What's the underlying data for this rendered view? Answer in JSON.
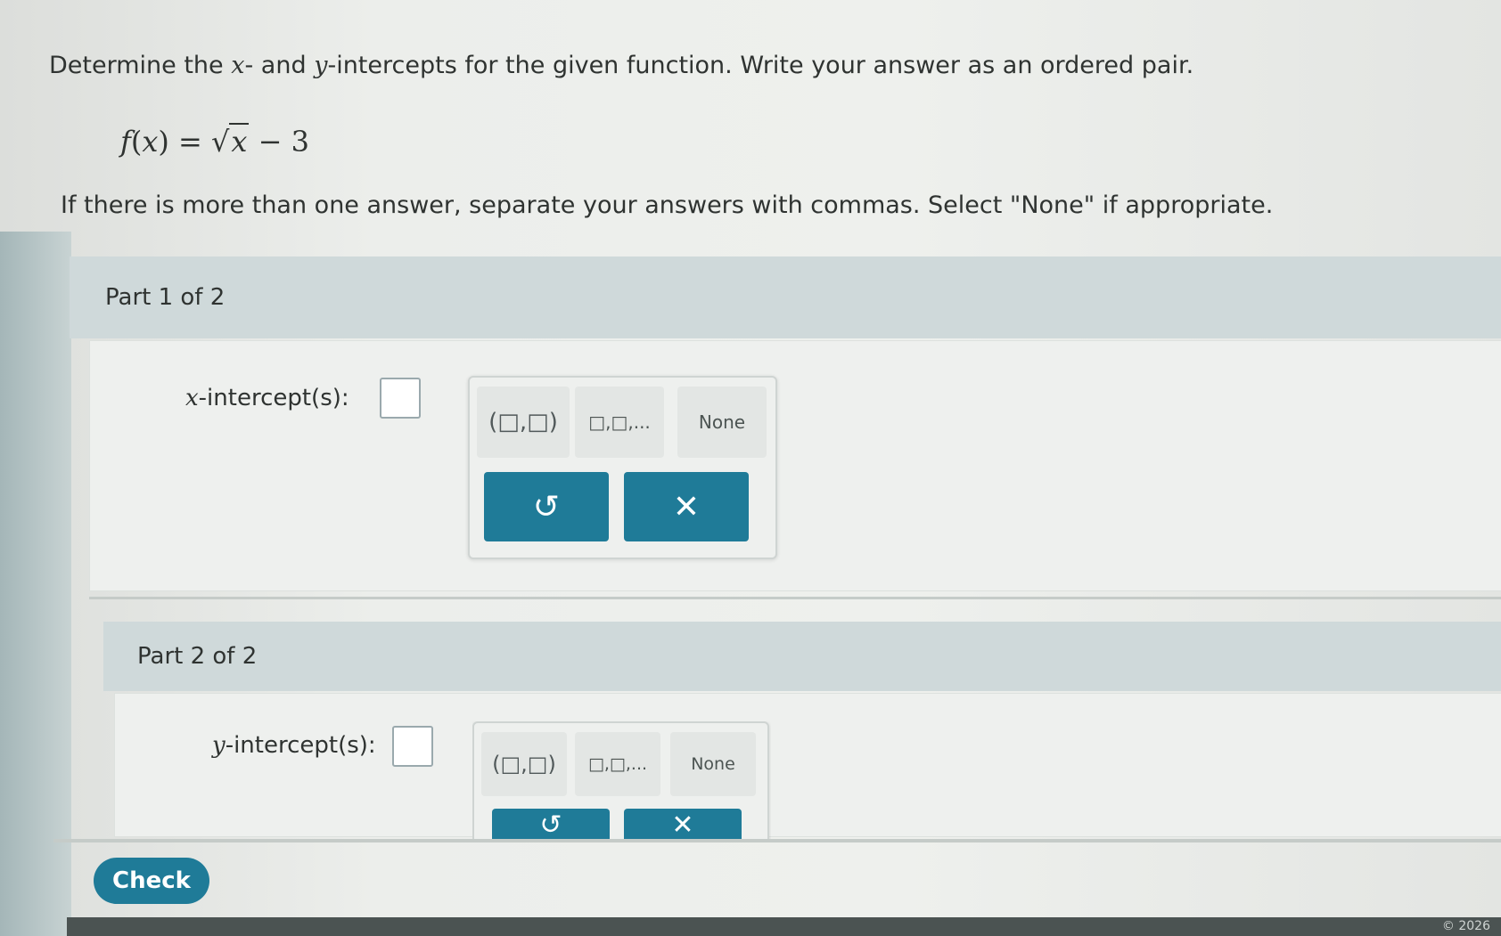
{
  "instructions": {
    "line1_a": "Determine the ",
    "x_var": "x",
    "line1_b": "- and ",
    "y_var": "y",
    "line1_c": "-intercepts for the given function. Write your answer as an ordered pair.",
    "line2": "If there is more than one answer, separate your answers with commas. Select \"None\" if appropriate."
  },
  "function": {
    "f": "f",
    "open": "(",
    "x": "x",
    "close": ")",
    "eq": " = ",
    "radical": "√",
    "radicand": "x",
    "tail": " − 3"
  },
  "parts": [
    {
      "header": "Part 1 of 2",
      "var": "x",
      "label": "-intercept(s):",
      "keypad": {
        "ordered_pair": "(□,□)",
        "list": "□,□,...",
        "none": "None",
        "undo_icon": "undo-icon",
        "clear_icon": "close-icon",
        "undo_glyph": "↺",
        "clear_glyph": "✕"
      }
    },
    {
      "header": "Part 2 of 2",
      "var": "y",
      "label": "-intercept(s):",
      "keypad": {
        "ordered_pair": "(□,□)",
        "list": "□,□,...",
        "none": "None",
        "undo_icon": "undo-icon",
        "clear_icon": "close-icon",
        "undo_glyph": "↺",
        "clear_glyph": "✕"
      }
    }
  ],
  "check_button": "Check",
  "copyright": "© 2026",
  "colors": {
    "accent": "#1f7b98",
    "header_bg": "#cfd9da",
    "page_bg": "#eef0ed"
  }
}
